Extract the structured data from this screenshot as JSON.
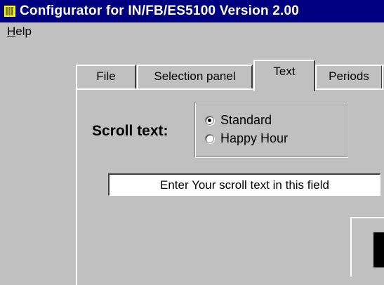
{
  "window": {
    "title": "Configurator for IN/FB/ES5100 Version 2.00",
    "icon": "app-icon"
  },
  "menu": {
    "items": [
      {
        "label": "Help"
      }
    ]
  },
  "tabs": [
    {
      "label": "File",
      "active": false
    },
    {
      "label": "Selection panel",
      "active": false
    },
    {
      "label": "Text",
      "active": true
    },
    {
      "label": "Periods",
      "active": false
    }
  ],
  "text_tab": {
    "scroll_label": "Scroll text:",
    "options": [
      {
        "label": "Standard",
        "selected": true
      },
      {
        "label": "Happy Hour",
        "selected": false
      }
    ],
    "scroll_input": {
      "value": "Enter Your scroll text in this field"
    }
  },
  "colors": {
    "titlebar": "#000080",
    "face": "#c0c0c0"
  }
}
